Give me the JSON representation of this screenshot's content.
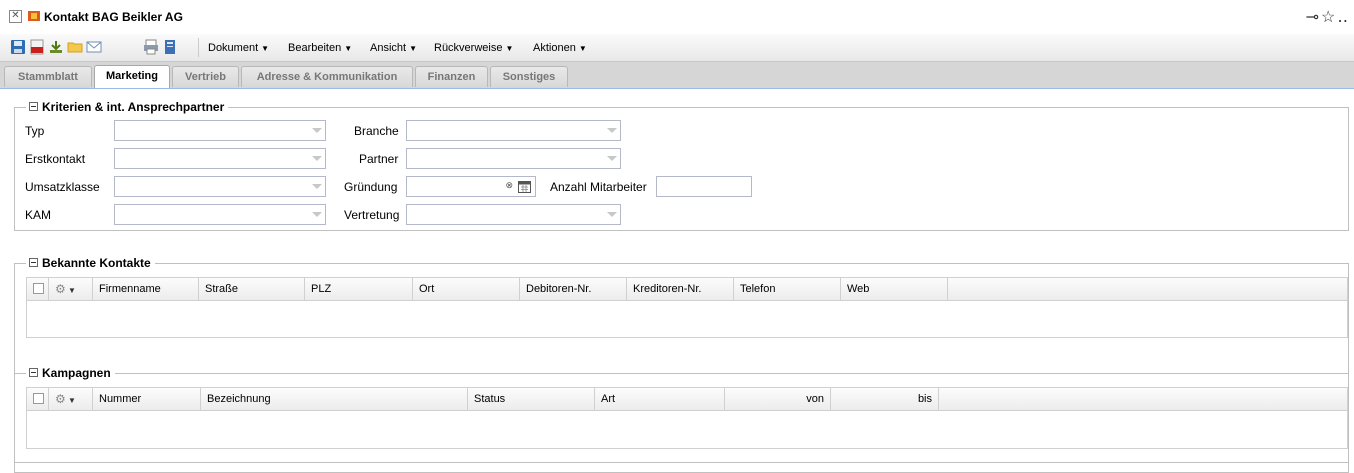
{
  "window": {
    "title": "Kontakt BAG Beikler AG",
    "right_glyphs": "⊸☆‥"
  },
  "toolbar": {
    "menus": [
      "Dokument",
      "Bearbeiten",
      "Ansicht",
      "Rückverweise",
      "Aktionen"
    ],
    "icons": [
      "save-icon",
      "pdf-icon",
      "download-icon",
      "folder-icon",
      "mail-icon",
      "print-icon",
      "document-icon"
    ]
  },
  "tabs": [
    "Stammblatt",
    "Marketing",
    "Vertrieb",
    "Adresse & Kommunikation",
    "Finanzen",
    "Sonstiges"
  ],
  "active_tab": "Marketing",
  "kriterien": {
    "legend": "Kriterien & int. Ansprechpartner",
    "typ": "Typ",
    "erstkontakt": "Erstkontakt",
    "umsatzklasse": "Umsatzklasse",
    "kam": "KAM",
    "branche": "Branche",
    "partner": "Partner",
    "gruendung": "Gründung",
    "vertretung": "Vertretung",
    "anzahl_mitarbeiter": "Anzahl Mitarbeiter"
  },
  "kontakte": {
    "legend": "Bekannte Kontakte",
    "columns": [
      "Firmenname",
      "Straße",
      "PLZ",
      "Ort",
      "Debitoren-Nr.",
      "Kreditoren-Nr.",
      "Telefon",
      "Web"
    ]
  },
  "kampagnen": {
    "legend": "Kampagnen",
    "columns": [
      "Nummer",
      "Bezeichnung",
      "Status",
      "Art",
      "von",
      "bis"
    ]
  },
  "colors": {
    "tab_border": "#99bbe8",
    "save_blue": "#2e6db4",
    "pdf_red": "#c8201f"
  }
}
